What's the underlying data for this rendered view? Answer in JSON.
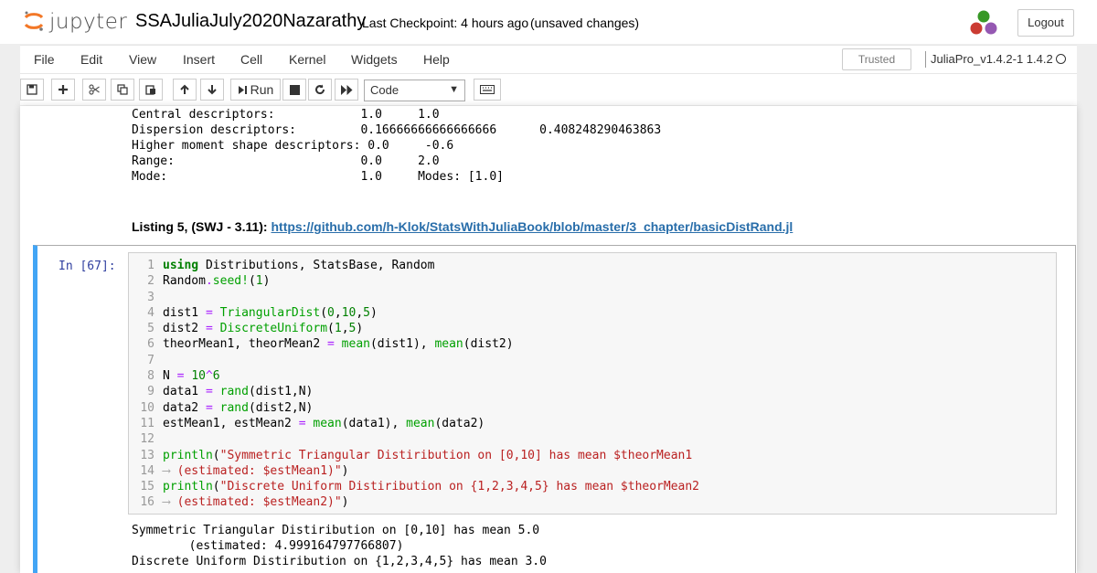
{
  "header": {
    "logo_text": "jupyter",
    "notebook_title": "SSAJuliaJuly2020Nazarathy",
    "checkpoint": "Last Checkpoint: 4 hours ago",
    "unsaved": "(unsaved changes)",
    "logout_label": "Logout"
  },
  "menu": {
    "items": [
      "File",
      "Edit",
      "View",
      "Insert",
      "Cell",
      "Kernel",
      "Widgets",
      "Help"
    ],
    "trusted": "Trusted",
    "kernel_name": "JuliaPro_v1.4.2-1 1.4.2"
  },
  "toolbar": {
    "run_label": "Run",
    "cell_type": "Code"
  },
  "prev_output": [
    "Central descriptors:            1.0     1.0",
    "Dispersion descriptors:         0.16666666666666666      0.408248290463863",
    "Higher moment shape descriptors: 0.0     -0.6",
    "Range:                          0.0     2.0",
    "Mode:                           1.0     Modes: [1.0]"
  ],
  "markdown": {
    "listing_label": "Listing 5, (SWJ - 3.11):",
    "listing_link": "https://github.com/h-Klok/StatsWithJuliaBook/blob/master/3_chapter/basicDistRand.jl"
  },
  "cell": {
    "prompt": "In [67]:",
    "line_numbers": [
      "1",
      "2",
      "3",
      "4",
      "5",
      "6",
      "7",
      "8",
      "9",
      "10",
      "11",
      "12",
      "13",
      "14",
      "15",
      "16"
    ],
    "output": [
      "Symmetric Triangular Distiribution on [0,10] has mean 5.0",
      "        (estimated: 4.999164797766807)",
      "Discrete Uniform Distiribution on {1,2,3,4,5} has mean 3.0"
    ]
  },
  "colors": {
    "selected_cell_border": "#42a5f5",
    "link": "#296eaa",
    "keyword": "#008000",
    "string": "#ba2121",
    "prompt": "#303f9f"
  }
}
